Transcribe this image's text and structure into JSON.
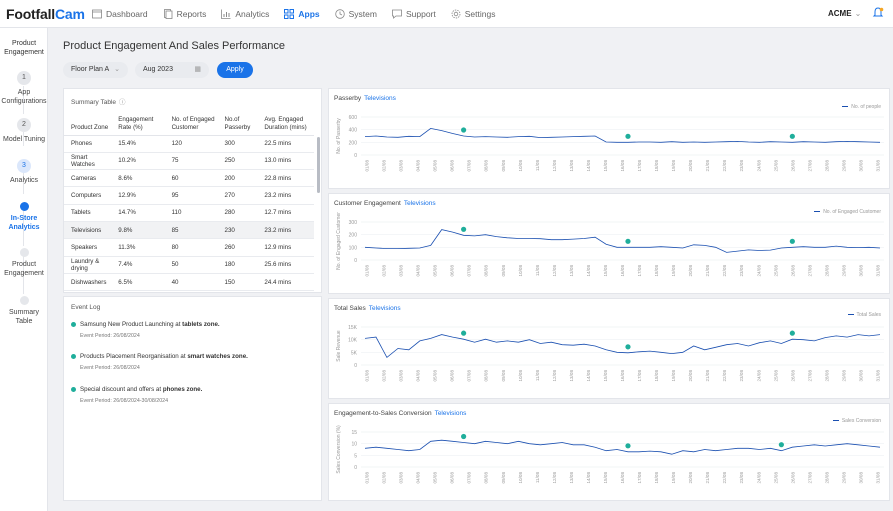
{
  "logo": {
    "part1": "Footfall",
    "part2": "Cam"
  },
  "nav": [
    {
      "label": "Dashboard",
      "icon": "dashboard-icon"
    },
    {
      "label": "Reports",
      "icon": "reports-icon"
    },
    {
      "label": "Analytics",
      "icon": "analytics-icon"
    },
    {
      "label": "Apps",
      "icon": "apps-icon"
    },
    {
      "label": "System",
      "icon": "system-icon"
    },
    {
      "label": "Support",
      "icon": "support-icon"
    },
    {
      "label": "Settings",
      "icon": "settings-icon"
    }
  ],
  "user": {
    "account": "ACME"
  },
  "sidebar": {
    "title": "Product Engagement",
    "steps": [
      {
        "num": "1",
        "label": "App Configurations"
      },
      {
        "num": "2",
        "label": "Model Tuning"
      },
      {
        "num": "3",
        "label": "Analytics"
      },
      {
        "num": "",
        "label": "In-Store Analytics"
      },
      {
        "num": "",
        "label": "Product Engagement"
      },
      {
        "num": "",
        "label": "Summary Table"
      }
    ]
  },
  "page": {
    "title": "Product Engagement And Sales Performance"
  },
  "filters": {
    "floor_plan": "Floor Plan A",
    "month": "Aug 2023",
    "apply_label": "Apply"
  },
  "summary": {
    "title": "Summary Table",
    "headers": [
      "Product Zone",
      "Engagement Rate (%)",
      "No. of Engaged Customer",
      "No.of Passerby",
      "Avg. Engaged Duration (mins)"
    ],
    "rows": [
      [
        "Phones",
        "15.4%",
        "120",
        "300",
        "22.5 mins"
      ],
      [
        "Smart Watches",
        "10.2%",
        "75",
        "250",
        "13.0 mins"
      ],
      [
        "Cameras",
        "8.6%",
        "60",
        "200",
        "22.8 mins"
      ],
      [
        "Computers",
        "12.9%",
        "95",
        "270",
        "23.2 mins"
      ],
      [
        "Tablets",
        "14.7%",
        "110",
        "280",
        "12.7 mins"
      ],
      [
        "Televisions",
        "9.8%",
        "85",
        "230",
        "23.2 mins"
      ],
      [
        "Speakers",
        "11.3%",
        "80",
        "260",
        "12.9 mins"
      ],
      [
        "Laundry & drying",
        "7.4%",
        "50",
        "180",
        "25.6 mins"
      ],
      [
        "Dishwashers",
        "6.5%",
        "40",
        "150",
        "24.4 mins"
      ]
    ]
  },
  "event_log": {
    "title": "Event Log",
    "events": [
      {
        "text": "Samsung New Product Launching at",
        "bold": "tablets zone.",
        "period": "Event Period: 26/08/2024"
      },
      {
        "text": "Products Placement Reorganisation at",
        "bold": "smart watches zone.",
        "period": "Event Period: 26/08/2024"
      },
      {
        "text": "Special discount and offers at",
        "bold": "phones zone.",
        "period": "Event Period: 26/08/2024-30/08/2024"
      }
    ]
  },
  "colors": {
    "accent": "#1a73e8",
    "line": "#1a4fb0",
    "marker": "#1fae9b"
  },
  "chart_data": [
    {
      "type": "line",
      "title": "Passerby",
      "tag": "Televisions",
      "ylabel": "No. of Passerby",
      "series": [
        {
          "name": "No. of people",
          "values": [
            290,
            300,
            285,
            280,
            295,
            290,
            420,
            385,
            340,
            300,
            285,
            290,
            285,
            280,
            290,
            295,
            275,
            280,
            285,
            290,
            295,
            300,
            205,
            200,
            200,
            205,
            205,
            200,
            210,
            200,
            205,
            200,
            205,
            210,
            215,
            205,
            200,
            210,
            205,
            200,
            210,
            205,
            200,
            210,
            215,
            210,
            205,
            200
          ]
        }
      ],
      "x": [
        "01/08",
        "02/08",
        "03/08",
        "04/08",
        "05/08",
        "06/08",
        "07/08",
        "08/08",
        "09/08",
        "10/08",
        "11/08",
        "12/08",
        "13/08",
        "14/08",
        "15/08",
        "16/08",
        "17/08",
        "18/08",
        "19/08",
        "20/08",
        "21/08",
        "22/08",
        "23/08",
        "24/08",
        "25/08",
        "26/08",
        "27/08",
        "28/08",
        "29/08",
        "30/08",
        "31/08"
      ],
      "yticks": [
        0,
        200,
        400,
        600
      ],
      "ylim": [
        0,
        600
      ],
      "markers": [
        6,
        15,
        25
      ]
    },
    {
      "type": "line",
      "title": "Customer Engagement",
      "tag": "Televisions",
      "ylabel": "No. of Engaged Customer",
      "series": [
        {
          "name": "No. of Engaged Customer",
          "values": [
            100,
            95,
            90,
            90,
            92,
            95,
            115,
            240,
            220,
            195,
            190,
            200,
            185,
            175,
            170,
            170,
            168,
            160,
            160,
            165,
            170,
            180,
            125,
            100,
            100,
            100,
            100,
            105,
            100,
            95,
            120,
            115,
            100,
            60,
            70,
            80,
            75,
            78,
            95,
            100,
            105,
            100,
            100,
            110,
            100,
            98,
            100,
            95
          ]
        }
      ],
      "x": [
        "01/08",
        "02/08",
        "03/08",
        "04/08",
        "05/08",
        "06/08",
        "07/08",
        "08/08",
        "09/08",
        "10/08",
        "11/08",
        "12/08",
        "13/08",
        "14/08",
        "15/08",
        "16/08",
        "17/08",
        "18/08",
        "19/08",
        "20/08",
        "21/08",
        "22/08",
        "23/08",
        "24/08",
        "25/08",
        "26/08",
        "27/08",
        "28/08",
        "29/08",
        "30/08",
        "31/08"
      ],
      "yticks": [
        0,
        100,
        200,
        300
      ],
      "ylim": [
        0,
        300
      ],
      "markers": [
        6,
        15,
        25
      ]
    },
    {
      "type": "line",
      "title": "Total Sales",
      "tag": "Televisions",
      "ylabel": "Sale Revenue",
      "series": [
        {
          "name": "Total Sales",
          "values": [
            10500,
            11000,
            3000,
            6500,
            6000,
            9500,
            10500,
            12000,
            11000,
            10200,
            9000,
            10200,
            9000,
            9500,
            9000,
            10000,
            8500,
            9000,
            8000,
            7800,
            8200,
            7500,
            6000,
            5000,
            4800,
            5200,
            5500,
            5000,
            4500,
            5000,
            7500,
            6000,
            7000,
            8000,
            8500,
            7500,
            8800,
            9500,
            8500,
            10200,
            10000,
            9500,
            10800,
            11500,
            11000,
            12000,
            11500,
            12000
          ]
        }
      ],
      "x": [
        "01/08",
        "02/08",
        "03/08",
        "04/08",
        "05/08",
        "06/08",
        "07/08",
        "08/08",
        "09/08",
        "10/08",
        "11/08",
        "12/08",
        "13/08",
        "14/08",
        "15/08",
        "16/08",
        "17/08",
        "18/08",
        "19/08",
        "20/08",
        "21/08",
        "22/08",
        "23/08",
        "24/08",
        "25/08",
        "26/08",
        "27/08",
        "28/08",
        "29/08",
        "30/08",
        "31/08"
      ],
      "yticks": [
        0,
        5000,
        10000,
        15000
      ],
      "yticklabels": [
        "0",
        "5K",
        "10K",
        "15K"
      ],
      "ylim": [
        0,
        15000
      ],
      "markers": [
        6,
        15,
        25
      ]
    },
    {
      "type": "line",
      "title": "Engagement-to-Sales Conversion",
      "tag": "Televisions",
      "ylabel": "Sales Conversion (%)",
      "series": [
        {
          "name": "Sales Conversion",
          "values": [
            8,
            8.5,
            8,
            7.5,
            7,
            7.5,
            11,
            11.5,
            11,
            10.5,
            10,
            11,
            10.5,
            10,
            11,
            10,
            9.5,
            10,
            10.5,
            9.5,
            9.5,
            8.5,
            7,
            7.5,
            6.5,
            6.5,
            6.8,
            6.5,
            5.5,
            7,
            6.5,
            7.5,
            7,
            7.5,
            8,
            8,
            7.5,
            8,
            7,
            8.5,
            9,
            9.5,
            9,
            9.5,
            10,
            9.5,
            9,
            8.5
          ]
        }
      ],
      "x": [
        "01/08",
        "02/08",
        "03/08",
        "04/08",
        "05/08",
        "06/08",
        "07/08",
        "08/08",
        "09/08",
        "10/08",
        "11/08",
        "12/08",
        "13/08",
        "14/08",
        "15/08",
        "16/08",
        "17/08",
        "18/08",
        "19/08",
        "20/08",
        "21/08",
        "22/08",
        "23/08",
        "24/08",
        "25/08",
        "26/08",
        "27/08",
        "28/08",
        "29/08",
        "30/08",
        "31/08"
      ],
      "yticks": [
        0,
        5,
        10,
        15
      ],
      "ylim": [
        0,
        15
      ],
      "markers": [
        6,
        15,
        24
      ]
    }
  ]
}
